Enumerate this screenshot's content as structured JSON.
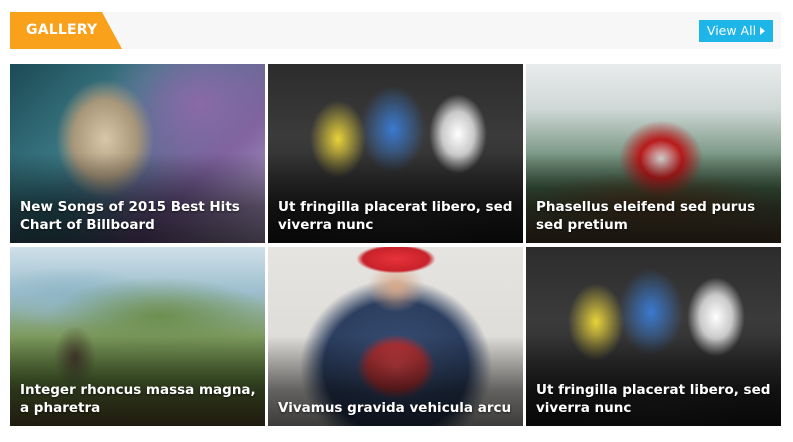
{
  "header": {
    "section_title": "GALLERY",
    "view_all_label": "View All",
    "accent_color": "#f9a11b",
    "button_color": "#1eb5e8"
  },
  "gallery": {
    "items": [
      {
        "caption": "New Songs of 2015 Best Hits Chart of Billboard",
        "image": "portrait-woman-purple"
      },
      {
        "caption": "Ut fringilla placerat libero, sed viverra nunc",
        "image": "road-cyclists"
      },
      {
        "caption": "Phasellus eleifend sed purus sed pretium",
        "image": "motocross-rider"
      },
      {
        "caption": "Integer rhoncus massa magna, a pharetra",
        "image": "mountain-bikers-coast"
      },
      {
        "caption": "Vivamus gravida vehicula arcu",
        "image": "man-heart-tshirt"
      },
      {
        "caption": "Ut fringilla placerat libero, sed viverra nunc",
        "image": "road-cyclists"
      }
    ]
  }
}
